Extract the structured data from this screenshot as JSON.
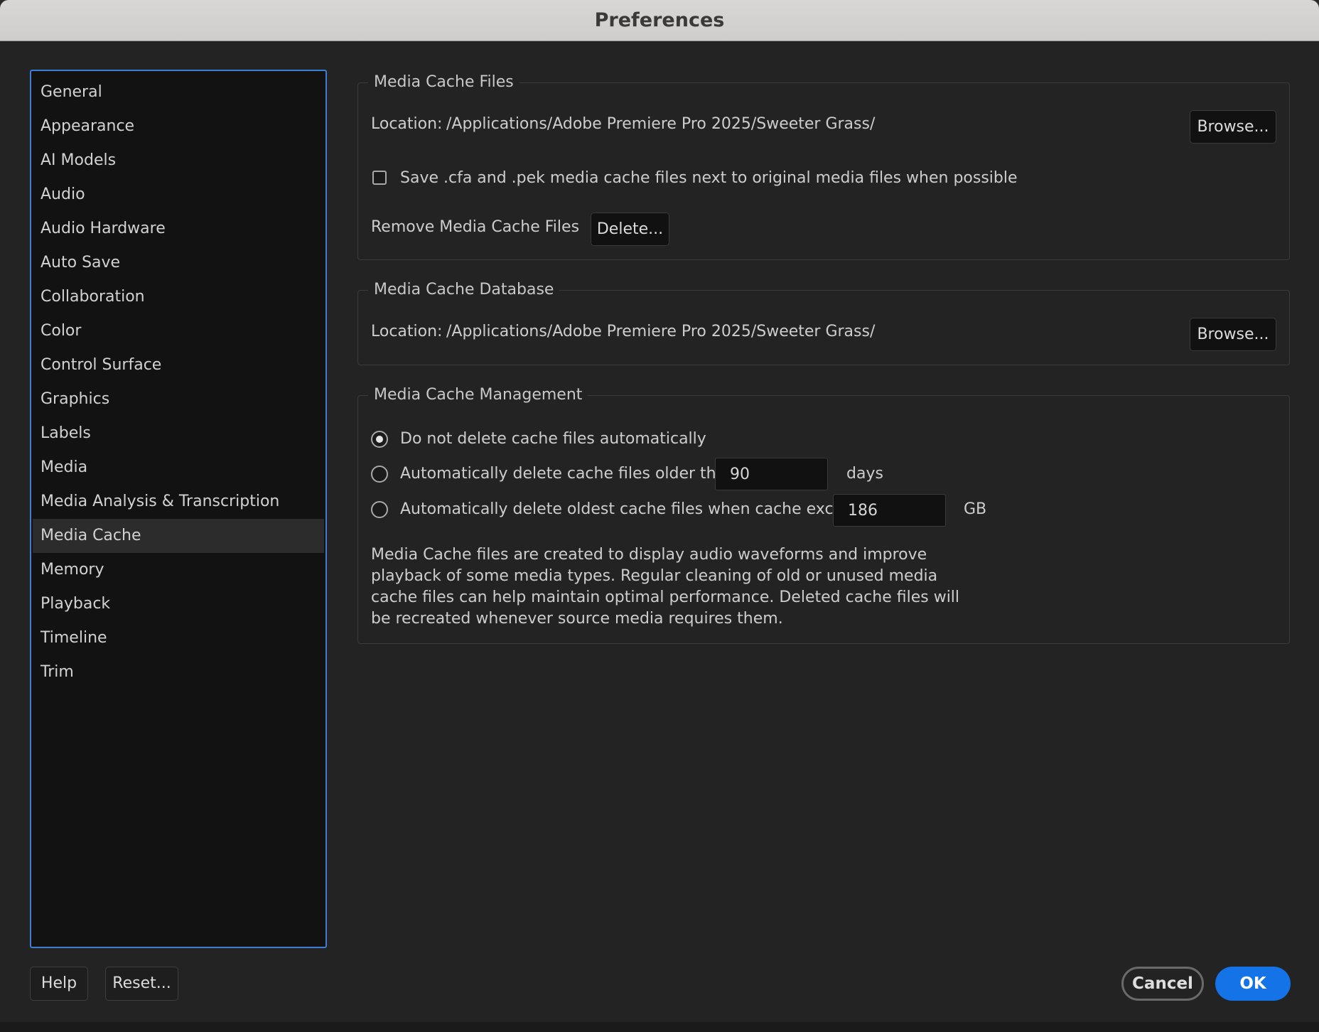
{
  "window": {
    "title": "Preferences"
  },
  "sidebar": {
    "items": [
      {
        "label": "General"
      },
      {
        "label": "Appearance"
      },
      {
        "label": "AI Models"
      },
      {
        "label": "Audio"
      },
      {
        "label": "Audio Hardware"
      },
      {
        "label": "Auto Save"
      },
      {
        "label": "Collaboration"
      },
      {
        "label": "Color"
      },
      {
        "label": "Control Surface"
      },
      {
        "label": "Graphics"
      },
      {
        "label": "Labels"
      },
      {
        "label": "Media"
      },
      {
        "label": "Media Analysis & Transcription"
      },
      {
        "label": "Media Cache",
        "selected": true
      },
      {
        "label": "Memory"
      },
      {
        "label": "Playback"
      },
      {
        "label": "Timeline"
      },
      {
        "label": "Trim"
      }
    ]
  },
  "media_cache_files": {
    "title": "Media Cache Files",
    "location_label": "Location:",
    "location_path": "/Applications/Adobe Premiere Pro 2025/Sweeter Grass/",
    "browse_label": "Browse...",
    "save_next_to_media_label": "Save .cfa and .pek media cache files next to original media files when possible",
    "save_next_to_media_checked": false,
    "remove_label": "Remove Media Cache Files",
    "delete_label": "Delete..."
  },
  "media_cache_database": {
    "title": "Media Cache Database",
    "location_label": "Location:",
    "location_path": "/Applications/Adobe Premiere Pro 2025/Sweeter Grass/",
    "browse_label": "Browse..."
  },
  "media_cache_management": {
    "title": "Media Cache Management",
    "option_no_delete": "Do not delete cache files automatically",
    "option_older_than": "Automatically delete cache files older than:",
    "older_than_value": "90",
    "older_than_unit": "days",
    "option_exceeds": "Automatically delete oldest cache files when cache exceeds:",
    "exceeds_value": "186",
    "exceeds_unit": "GB",
    "selected_option": "no_delete",
    "description": "Media Cache files are created to display audio waveforms and improve playback of some media types.  Regular cleaning of old or unused media cache files can help maintain optimal performance. Deleted cache files will be recreated whenever source media requires them."
  },
  "footer": {
    "help_label": "Help",
    "reset_label": "Reset...",
    "cancel_label": "Cancel",
    "ok_label": "OK"
  },
  "colors": {
    "accent": "#1473e6",
    "sidebar_border": "#3a7fd5",
    "background": "#232323"
  }
}
